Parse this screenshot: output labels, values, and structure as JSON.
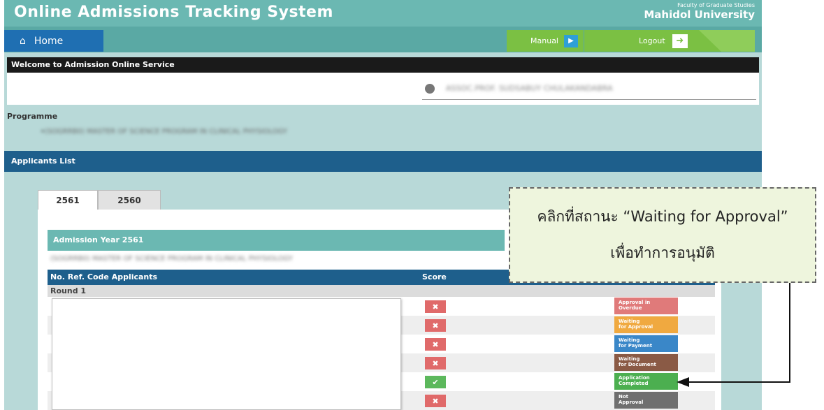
{
  "app": {
    "title": "Online Admissions Tracking System",
    "faculty": "Faculty of Graduate Studies",
    "university": "Mahidol University"
  },
  "nav": {
    "home": "Home",
    "manual": "Manual",
    "logout": "Logout"
  },
  "welcome": {
    "title": "Welcome to Admission Online Service",
    "user_name": "ASSOC.PROF. SUDSABUY CHULAKANDABRA"
  },
  "programme": {
    "label": "Programme",
    "item": "(SOGRRB0) MASTER OF SCIENCE PROGRAM IN CLINICAL PHYSIOLOGY"
  },
  "applicants": {
    "header": "Applicants List",
    "tabs": [
      "2561",
      "2560"
    ],
    "admission_year": "Admission Year 2561",
    "program_line": "(SOGRRB0) MASTER OF SCIENCE PROGRAM IN CLINICAL PHYSIOLOGY",
    "columns": {
      "no": "No. Ref. Code Applicants",
      "score": "Score"
    },
    "round": "Round 1",
    "rows": [
      {
        "score_icon": "✖",
        "status_l1": "Approval in",
        "status_l2": "Overdue"
      },
      {
        "score_icon": "✖",
        "status_l1": "Waiting",
        "status_l2": "for Approval"
      },
      {
        "score_icon": "✖",
        "status_l1": "Waiting",
        "status_l2": "for Payment"
      },
      {
        "score_icon": "✖",
        "status_l1": "Waiting",
        "status_l2": "for Document"
      },
      {
        "score_icon": "✔",
        "status_l1": "Application",
        "status_l2": "Completed"
      },
      {
        "score_icon": "✖",
        "status_l1": "Not",
        "status_l2": "Approval"
      }
    ]
  },
  "callout": {
    "line1": "คลิกที่สถานะ “Waiting for Approval”",
    "line2": "เพื่อทำการอนุมัติ"
  },
  "colors": {
    "teal": "#6bb8b2",
    "navy": "#1e5f8c",
    "home_blue": "#1f6fb2",
    "green": "#7bc043",
    "status_overdue": "#e07a7a",
    "status_approval": "#f0a940",
    "status_payment": "#3a87c8",
    "status_document": "#8a5a45",
    "status_completed": "#4caf50",
    "status_not_approval": "#6f6f6f"
  }
}
